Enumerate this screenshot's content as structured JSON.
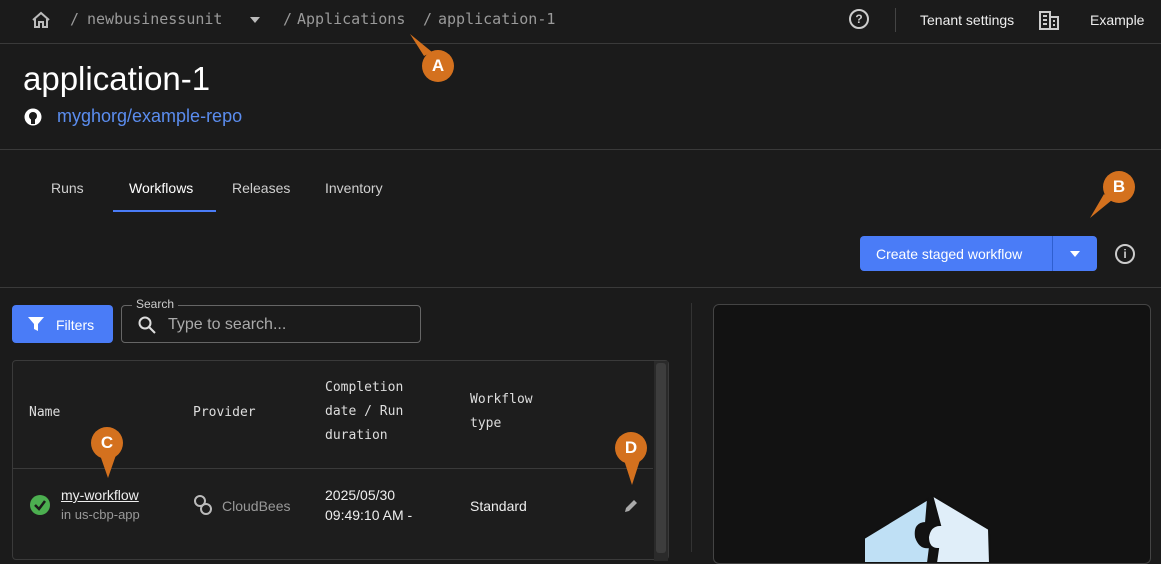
{
  "breadcrumb": {
    "org": "newbusinessunit",
    "applications": "Applications",
    "current": "application-1",
    "sep": "/"
  },
  "topbar": {
    "tenant_settings": "Tenant settings",
    "user": "Example"
  },
  "header": {
    "title": "application-1",
    "repo": "myghorg/example-repo"
  },
  "tabs": [
    {
      "label": "Runs"
    },
    {
      "label": "Workflows",
      "active": true
    },
    {
      "label": "Releases"
    },
    {
      "label": "Inventory"
    }
  ],
  "actions": {
    "create": "Create staged workflow"
  },
  "filters": {
    "label": "Filters",
    "search_label": "Search",
    "search_placeholder": "Type to search..."
  },
  "table": {
    "headers": [
      "Name",
      "Provider",
      "Completion date / Run duration",
      "Workflow type"
    ],
    "rows": [
      {
        "name": "my-workflow",
        "sub": "in us-cbp-app",
        "provider": "CloudBees",
        "date": "2025/05/30",
        "time": "09:49:10 AM -",
        "type": "Standard"
      }
    ]
  },
  "callouts": [
    "A",
    "B",
    "C",
    "D"
  ],
  "colors": {
    "accent": "#4a7cf7",
    "callout": "#d4711e",
    "success": "#4caf50"
  }
}
